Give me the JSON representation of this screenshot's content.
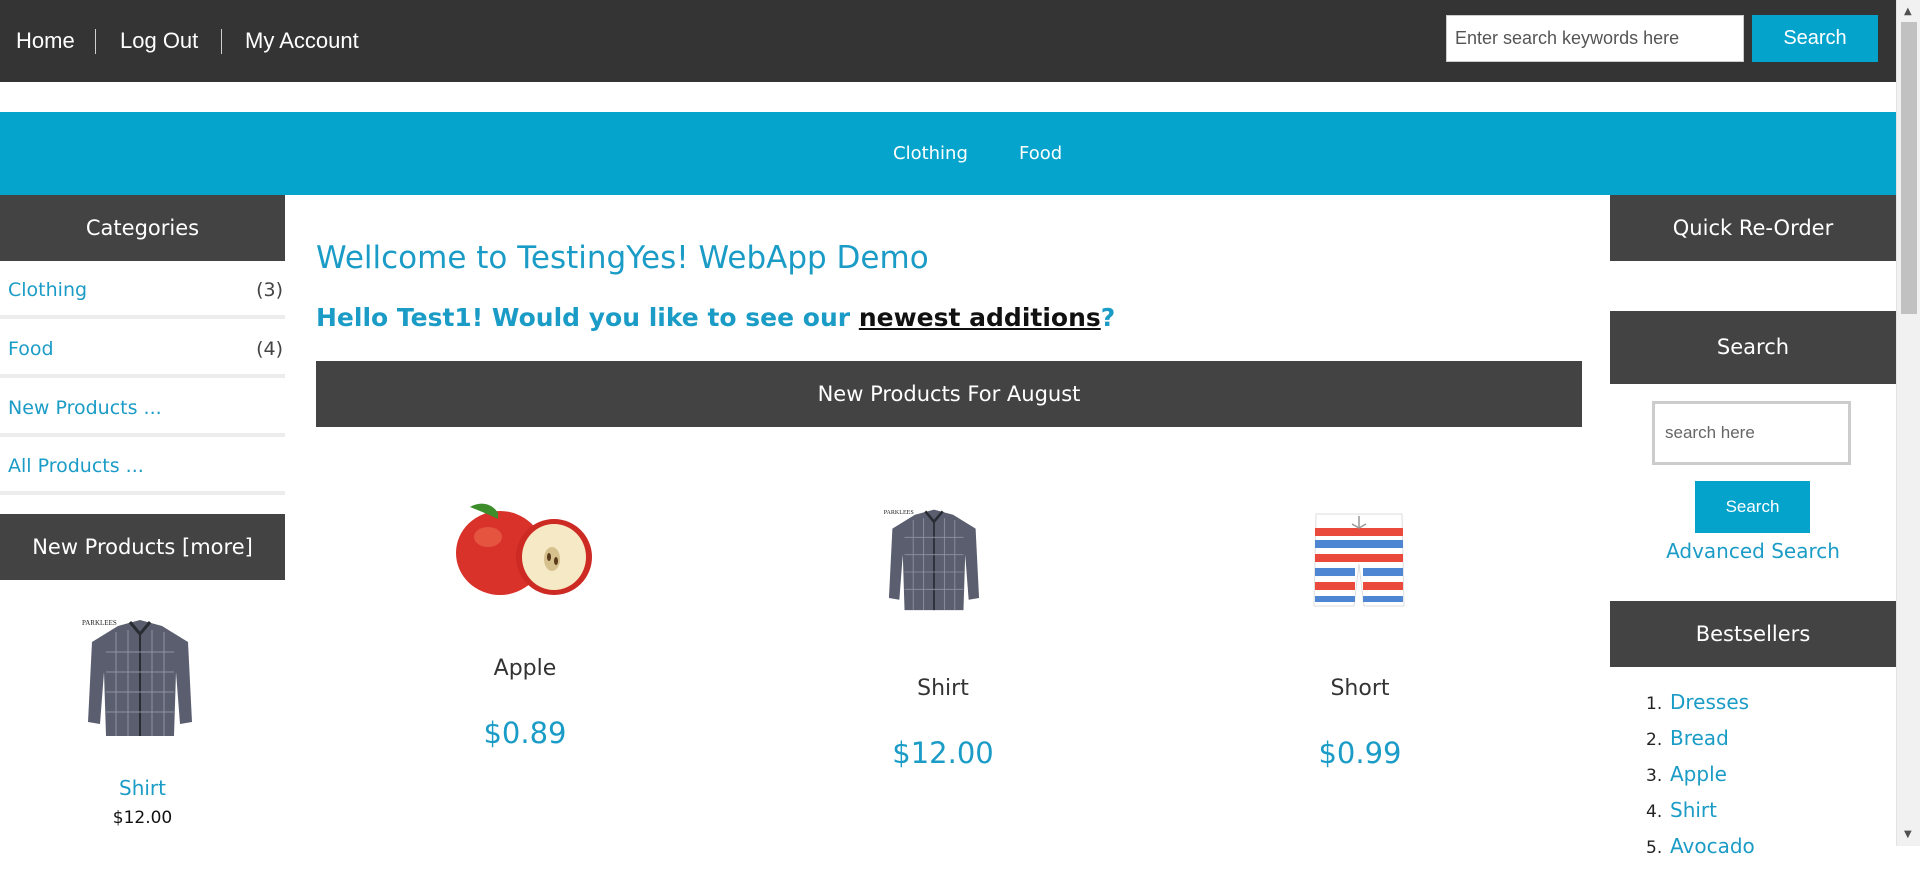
{
  "topbar": {
    "links": [
      "Home",
      "Log Out",
      "My Account"
    ],
    "search_placeholder": "Enter search keywords here",
    "search_button": "Search"
  },
  "catbar": {
    "links": [
      "Clothing",
      "Food"
    ]
  },
  "left": {
    "categories_title": "Categories",
    "categories": [
      {
        "label": "Clothing",
        "count": "(3)"
      },
      {
        "label": "Food",
        "count": "(4)"
      },
      {
        "label": "New Products ...",
        "count": ""
      },
      {
        "label": "All Products ...",
        "count": ""
      }
    ],
    "new_products_title": "New Products  [more]",
    "new_product": {
      "name": "Shirt",
      "price": "$12.00"
    }
  },
  "main": {
    "welcome": "Wellcome to TestingYes! WebApp Demo",
    "hello_prefix": "Hello Test1! Would you like to see our ",
    "hello_link": "newest additions",
    "hello_suffix": "?",
    "new_products_heading": "New Products For August",
    "products": [
      {
        "name": "Apple",
        "price": "$0.89",
        "icon": "apple-image"
      },
      {
        "name": "Shirt",
        "price": "$12.00",
        "icon": "shirt-image"
      },
      {
        "name": "Short",
        "price": "$0.99",
        "icon": "shorts-image"
      }
    ]
  },
  "right": {
    "quick_reorder_title": "Quick Re-Order",
    "search_title": "Search",
    "search_placeholder": "search here",
    "search_button": "Search",
    "advanced_search": "Advanced Search",
    "bestsellers_title": "Bestsellers",
    "bestsellers": [
      {
        "num": "1.",
        "label": "Dresses"
      },
      {
        "num": "2.",
        "label": "Bread"
      },
      {
        "num": "3.",
        "label": "Apple"
      },
      {
        "num": "4.",
        "label": "Shirt"
      },
      {
        "num": "5.",
        "label": "Avocado"
      }
    ]
  },
  "colors": {
    "accent": "#05a4cc",
    "dark_header": "#343434",
    "panel_header": "#434343",
    "link": "#1b9cc6"
  }
}
